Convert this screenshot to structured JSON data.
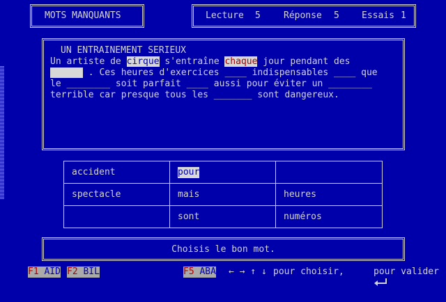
{
  "title": "MOTS MANQUANTS",
  "stats": [
    {
      "label": "Lecture",
      "value": "5"
    },
    {
      "label": "Réponse",
      "value": "5"
    },
    {
      "label": "Essais",
      "value": "1"
    }
  ],
  "text": {
    "heading": "UN ENTRAINEMENT SERIEUX",
    "line1_a": "Un artiste de ",
    "line1_w1": "cirque",
    "line1_b": " s'entraîne ",
    "line1_w2": "chaque",
    "line1_c": " jour pendant des",
    "line2_blank": "      ",
    "line2_rest": " . Ces heures d'exercices ____ indispensables ____ que",
    "line3": "le ________ soit parfait ____ aussi pour éviter un ________",
    "line4": "terrible car presque tous les _______ sont dangereux."
  },
  "choices": [
    [
      "accident",
      "pour",
      ""
    ],
    [
      "spectacle",
      "mais",
      "heures"
    ],
    [
      "",
      "sont",
      "numéros"
    ]
  ],
  "selected_choice": "pour",
  "status": "Choisis le bon mot.",
  "footer": {
    "f1_key": "F1",
    "f1_label": " AID",
    "f2_key": "F2",
    "f2_label": " BIL",
    "f5_key": "F5",
    "f5_label": " ABA",
    "arrows": "← → ↑ ↓",
    "choose": "pour choisir,",
    "validate": "pour valider"
  }
}
